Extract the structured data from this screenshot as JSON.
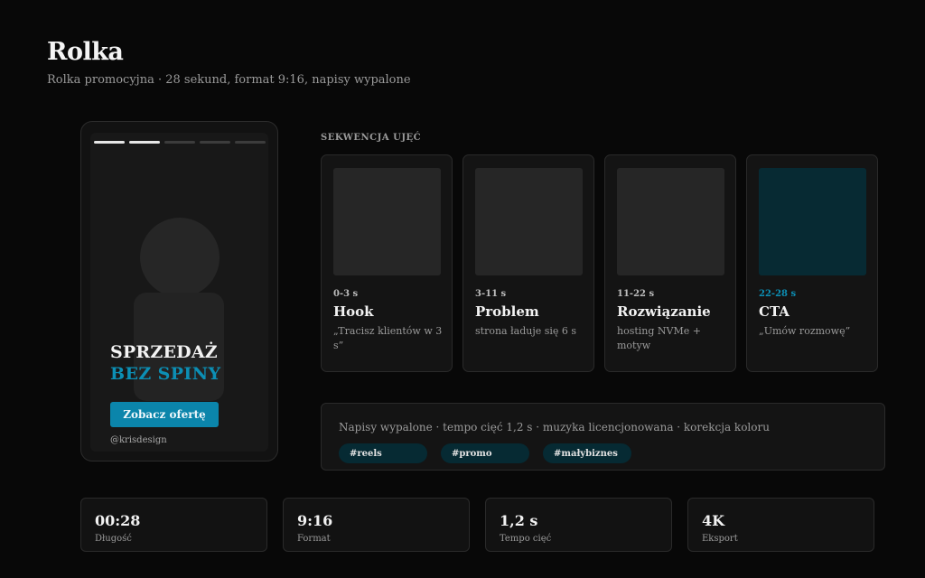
{
  "page": {
    "title": "Rolka",
    "subtitle": "Rolka promocyjna · 28 sekund, format 9:16, napisy wypalone"
  },
  "preview": {
    "progress_segments": 5,
    "progress_done": 2,
    "headline_1": "SPRZEDAŻ",
    "headline_2": "BEZ SPINY",
    "cta_label": "Zobacz ofertę",
    "handle": "@krisdesign"
  },
  "sequence": {
    "label": "SEKWENCJA UJĘĆ",
    "shots": [
      {
        "time": "0-3 s",
        "title": "Hook",
        "desc": "„Tracisz klientów w 3 s”",
        "accent": false
      },
      {
        "time": "3-11 s",
        "title": "Problem",
        "desc": "strona ładuje się 6 s",
        "accent": false
      },
      {
        "time": "11-22 s",
        "title": "Rozwiązanie",
        "desc": "hosting NVMe + motyw",
        "accent": false
      },
      {
        "time": "22-28 s",
        "title": "CTA",
        "desc": "„Umów rozmowę”",
        "accent": true
      }
    ]
  },
  "info": {
    "text": "Napisy wypalone · tempo cięć 1,2 s · muzyka licencjonowana · korekcja koloru",
    "tags": [
      "#reels",
      "#promo",
      "#małybiznes"
    ]
  },
  "stats": [
    {
      "value": "00:28",
      "label": "Długość"
    },
    {
      "value": "9:16",
      "label": "Format"
    },
    {
      "value": "1,2 s",
      "label": "Tempo cięć"
    },
    {
      "value": "4K",
      "label": "Eksport"
    }
  ],
  "colors": {
    "accent": "#0b85ab",
    "accent_text": "#0c8fb5",
    "background": "#080808"
  }
}
